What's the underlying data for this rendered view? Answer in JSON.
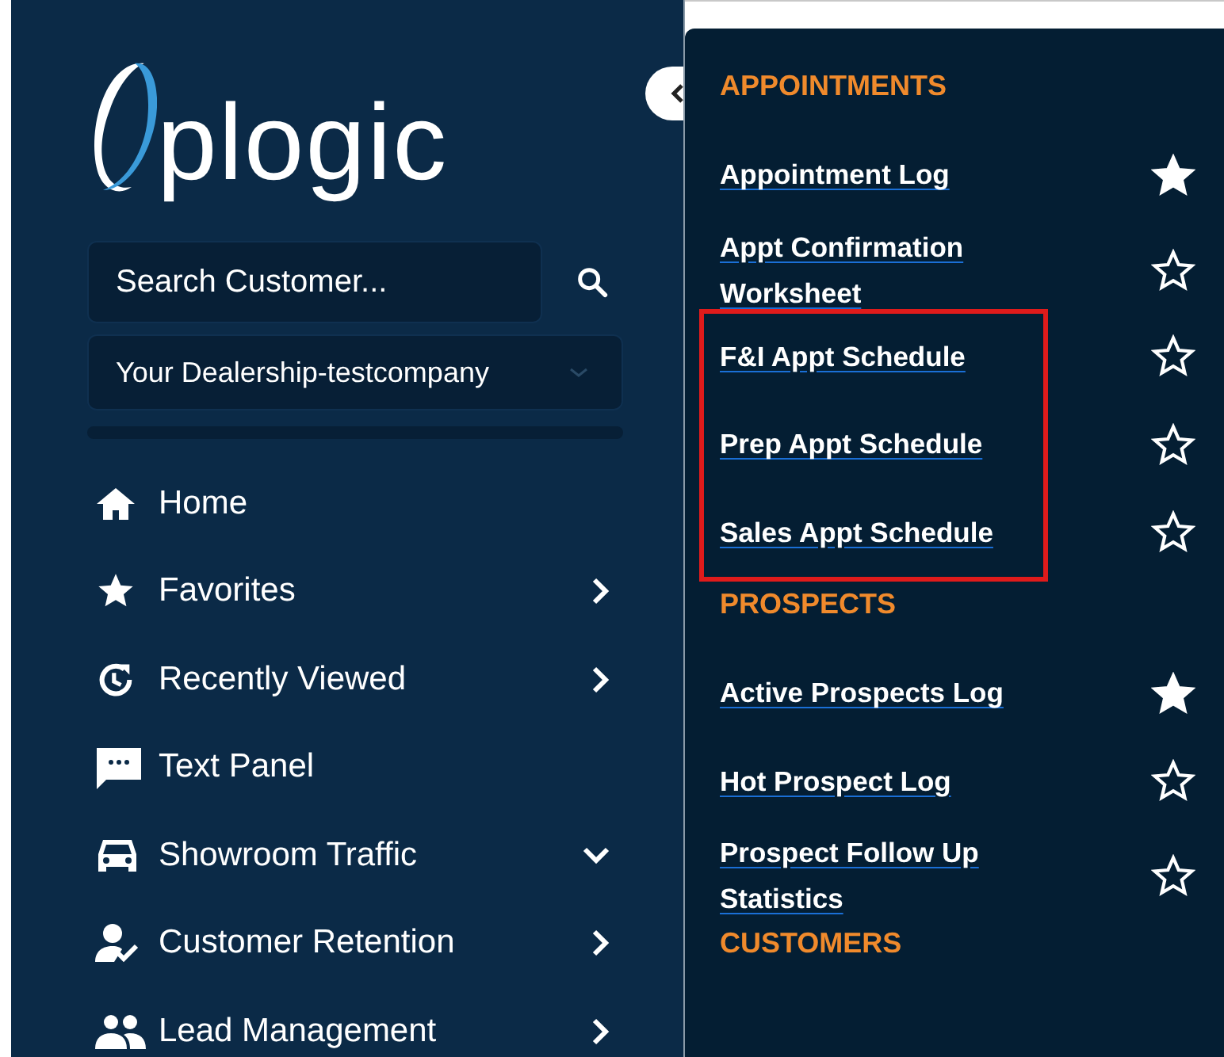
{
  "sidebar": {
    "logo": {
      "text": "plogic"
    },
    "search": {
      "placeholder": "Search Customer..."
    },
    "dealership": {
      "value": "Your Dealership-testcompany"
    },
    "items": [
      {
        "label": "Home"
      },
      {
        "label": "Favorites",
        "expanded": false
      },
      {
        "label": "Recently Viewed",
        "expanded": false
      },
      {
        "label": "Text Panel"
      },
      {
        "label": "Showroom Traffic",
        "expanded": true
      },
      {
        "label": "Customer Retention",
        "expanded": false
      },
      {
        "label": "Lead Management",
        "expanded": false
      }
    ]
  },
  "submenu": {
    "sections": [
      {
        "title": "APPOINTMENTS",
        "items": [
          {
            "label": "Appointment Log",
            "favorite": true,
            "highlighted": false
          },
          {
            "label": "Appt Confirmation Worksheet",
            "favorite": false,
            "highlighted": false
          },
          {
            "label": "F&I Appt Schedule",
            "favorite": false,
            "highlighted": true
          },
          {
            "label": "Prep Appt Schedule",
            "favorite": false,
            "highlighted": true
          },
          {
            "label": "Sales Appt Schedule",
            "favorite": false,
            "highlighted": true
          }
        ]
      },
      {
        "title": "PROSPECTS",
        "items": [
          {
            "label": "Active Prospects Log",
            "favorite": true,
            "highlighted": false
          },
          {
            "label": "Hot Prospect Log",
            "favorite": false,
            "highlighted": false
          },
          {
            "label": "Prospect Follow Up Statistics",
            "favorite": false,
            "highlighted": false
          }
        ]
      },
      {
        "title": "CUSTOMERS"
      }
    ]
  }
}
